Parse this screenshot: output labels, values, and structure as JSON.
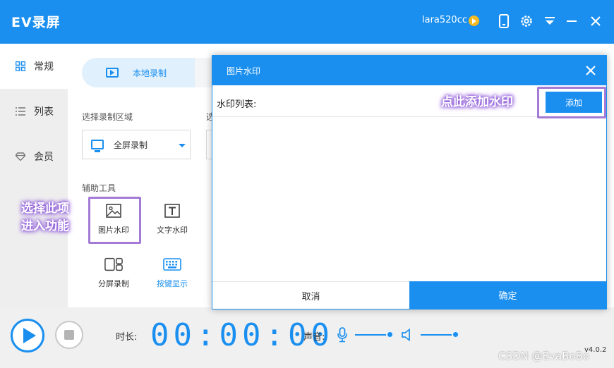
{
  "app": {
    "title": "EV录屏",
    "username": "lara520cc",
    "version": "v4.0.2"
  },
  "sidebar": {
    "items": [
      {
        "label": "常规",
        "icon": "grid-icon",
        "active": true
      },
      {
        "label": "列表",
        "icon": "list-icon",
        "active": false
      },
      {
        "label": "会员",
        "icon": "diamond-icon",
        "active": false
      }
    ]
  },
  "main": {
    "mode_tab_local": "本地录制",
    "record_area_label": "选择录制区域",
    "record_area_value": "全屏录制",
    "second_label_clip": "选",
    "tools_label": "辅助工具",
    "tools": {
      "image_watermark": "图片水印",
      "text_watermark": "文字水印",
      "split_record": "分屏录制",
      "key_display": "按键显示"
    }
  },
  "annotations": {
    "select_item_line1": "选择此项",
    "select_item_line2": "进入功能",
    "add_here": "点此添加水印"
  },
  "dialog": {
    "title": "图片水印",
    "list_label": "水印列表:",
    "add_button": "添加",
    "cancel_button": "取消",
    "ok_button": "确定"
  },
  "player": {
    "duration_label": "时长:",
    "timer": "00:00:00",
    "sound_label": "声音:",
    "mic_level": 0.9,
    "speaker_level": 0.9
  },
  "watermark_text": "CSDN @EvaBoBo",
  "colors": {
    "accent": "#1a8ff0",
    "annotation": "#a37ad6",
    "vip": "#f5b921"
  }
}
